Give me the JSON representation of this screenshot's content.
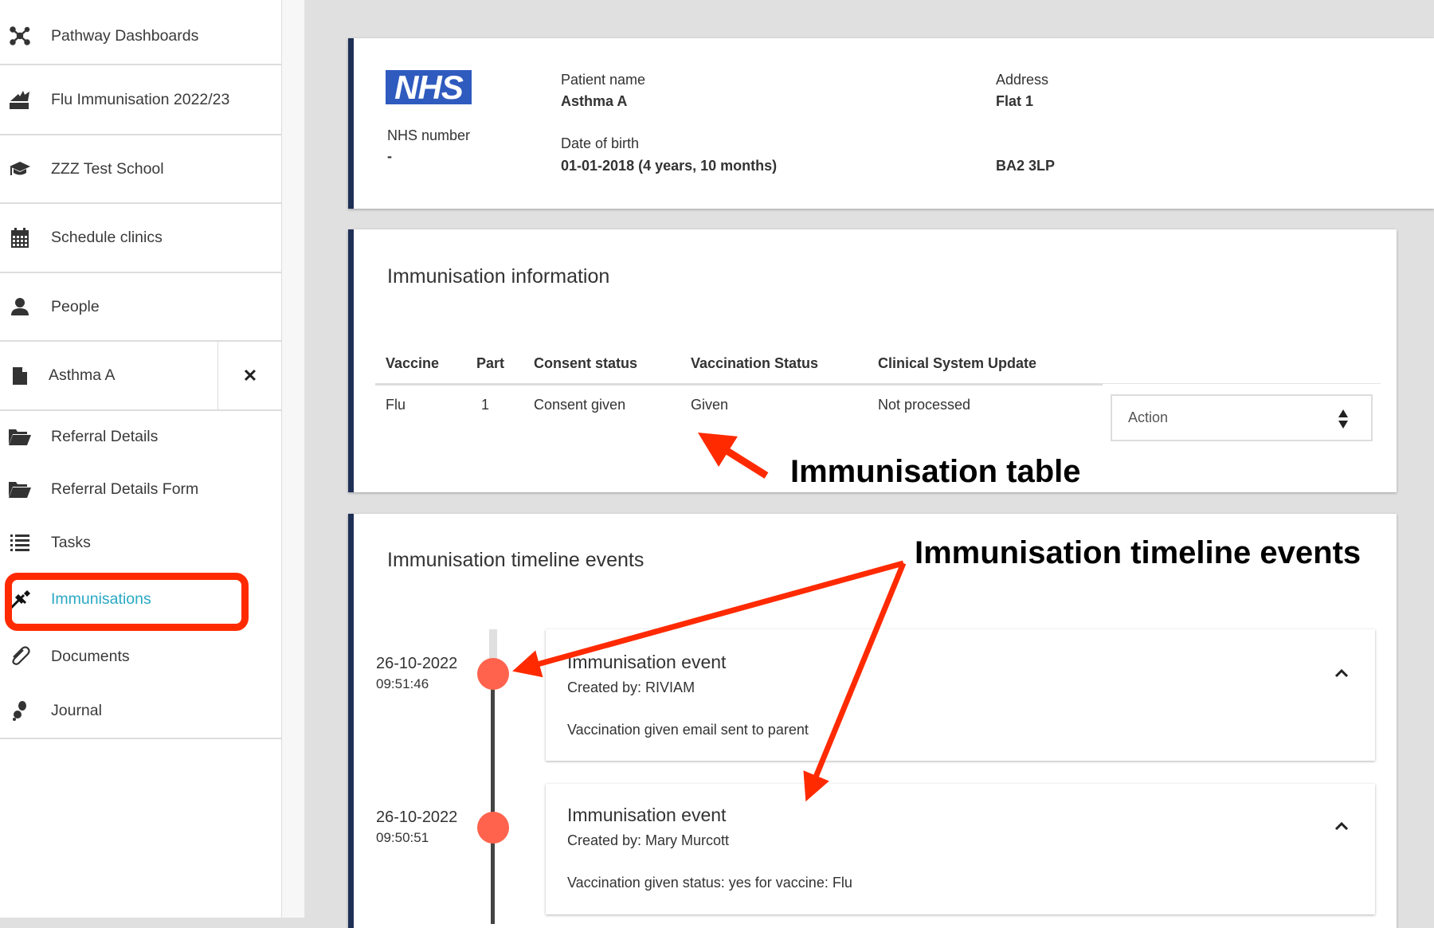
{
  "sidebar": {
    "items": [
      {
        "label": "Pathway Dashboards",
        "icon": "network-icon"
      },
      {
        "label": "Flu Immunisation 2022/23",
        "icon": "pathway-icon"
      },
      {
        "label": "ZZZ Test School",
        "icon": "graduation-cap-icon"
      },
      {
        "label": "Schedule clinics",
        "icon": "calendar-icon"
      },
      {
        "label": "People",
        "icon": "person-icon"
      },
      {
        "label": "Asthma A",
        "icon": "file-icon",
        "close": "✕"
      },
      {
        "label": "Referral Details",
        "icon": "folder-open-icon"
      },
      {
        "label": "Referral Details Form",
        "icon": "folder-open-icon"
      },
      {
        "label": "Tasks",
        "icon": "list-icon"
      },
      {
        "label": "Immunisations",
        "icon": "syringe-icon",
        "active": true
      },
      {
        "label": "Documents",
        "icon": "paperclip-icon"
      },
      {
        "label": "Journal",
        "icon": "footsteps-icon"
      }
    ],
    "active_color": "#29a8c4"
  },
  "patient": {
    "logo": "NHS",
    "nhs_number_label": "NHS number",
    "nhs_number": "-",
    "name_label": "Patient name",
    "name": "Asthma A",
    "dob_label": "Date of birth",
    "dob": "01-01-2018 (4 years, 10 months)",
    "address_label": "Address",
    "address_line1": "Flat 1",
    "postcode": "BA2 3LP"
  },
  "immunisation_info": {
    "title": "Immunisation information",
    "columns": [
      "Vaccine",
      "Part",
      "Consent status",
      "Vaccination Status",
      "Clinical System Update"
    ],
    "rows": [
      [
        "Flu",
        "1",
        "Consent given",
        "Given",
        "Not processed"
      ]
    ],
    "action_placeholder": "Action"
  },
  "timeline": {
    "title": "Immunisation timeline events",
    "events": [
      {
        "date": "26-10-2022",
        "time": "09:51:46",
        "title": "Immunisation event",
        "created_by": "Created by: RIVIAM",
        "description": "Vaccination given email sent to parent"
      },
      {
        "date": "26-10-2022",
        "time": "09:50:51",
        "title": "Immunisation event",
        "created_by": "Created by: Mary Murcott",
        "description": "Vaccination given status: yes for vaccine: Flu"
      }
    ],
    "dot_color": "#ff634d"
  },
  "annotations": {
    "table": "Immunisation table",
    "timeline": "Immunisation timeline events",
    "color": "#ff2a00"
  }
}
